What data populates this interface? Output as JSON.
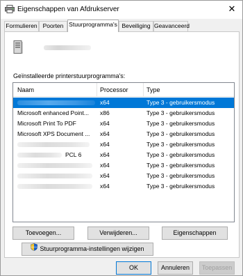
{
  "window": {
    "title": "Eigenschappen van Afdrukserver",
    "close_glyph": "✕"
  },
  "tabs": [
    {
      "label": "Formulieren",
      "active": false
    },
    {
      "label": "Poorten",
      "active": false
    },
    {
      "label": "Stuurprogramma's",
      "active": true
    },
    {
      "label": "Beveiliging",
      "active": false
    },
    {
      "label": "Geavanceerd",
      "active": false
    }
  ],
  "drivers": {
    "section_label": "Geïnstalleerde printerstuurprogramma's:",
    "columns": {
      "name": "Naam",
      "processor": "Processor",
      "type": "Type"
    },
    "rows": [
      {
        "name": "",
        "processor": "x64",
        "type": "Type 3 - gebruikersmodus",
        "selected": true,
        "name_hidden": true
      },
      {
        "name": "Microsoft enhanced Point...",
        "processor": "x86",
        "type": "Type 3 - gebruikersmodus",
        "selected": false,
        "name_hidden": false
      },
      {
        "name": "Microsoft Print To PDF",
        "processor": "x64",
        "type": "Type 3 - gebruikersmodus",
        "selected": false,
        "name_hidden": false
      },
      {
        "name": "Microsoft XPS Document ...",
        "processor": "x64",
        "type": "Type 3 - gebruikersmodus",
        "selected": false,
        "name_hidden": false
      },
      {
        "name": "",
        "processor": "x64",
        "type": "Type 3 - gebruikersmodus",
        "selected": false,
        "name_hidden": true
      },
      {
        "name": "PCL 6",
        "processor": "x64",
        "type": "Type 3 - gebruikersmodus",
        "selected": false,
        "name_hidden": true
      },
      {
        "name": "",
        "processor": "x64",
        "type": "Type 3 - gebruikersmodus",
        "selected": false,
        "name_hidden": true
      },
      {
        "name": "",
        "processor": "x64",
        "type": "Type 3 - gebruikersmodus",
        "selected": false,
        "name_hidden": true
      },
      {
        "name": "",
        "processor": "x64",
        "type": "Type 3 - gebruikersmodus",
        "selected": false,
        "name_hidden": true
      }
    ]
  },
  "buttons": {
    "add": "Toevoegen...",
    "remove": "Verwijderen...",
    "properties": "Eigenschappen",
    "change_settings": "Stuurprogramma-instellingen wijzigen",
    "ok": "OK",
    "cancel": "Annuleren",
    "apply": "Toepassen"
  },
  "colors": {
    "selection": "#0078d7",
    "accent_border": "#0078d7"
  }
}
